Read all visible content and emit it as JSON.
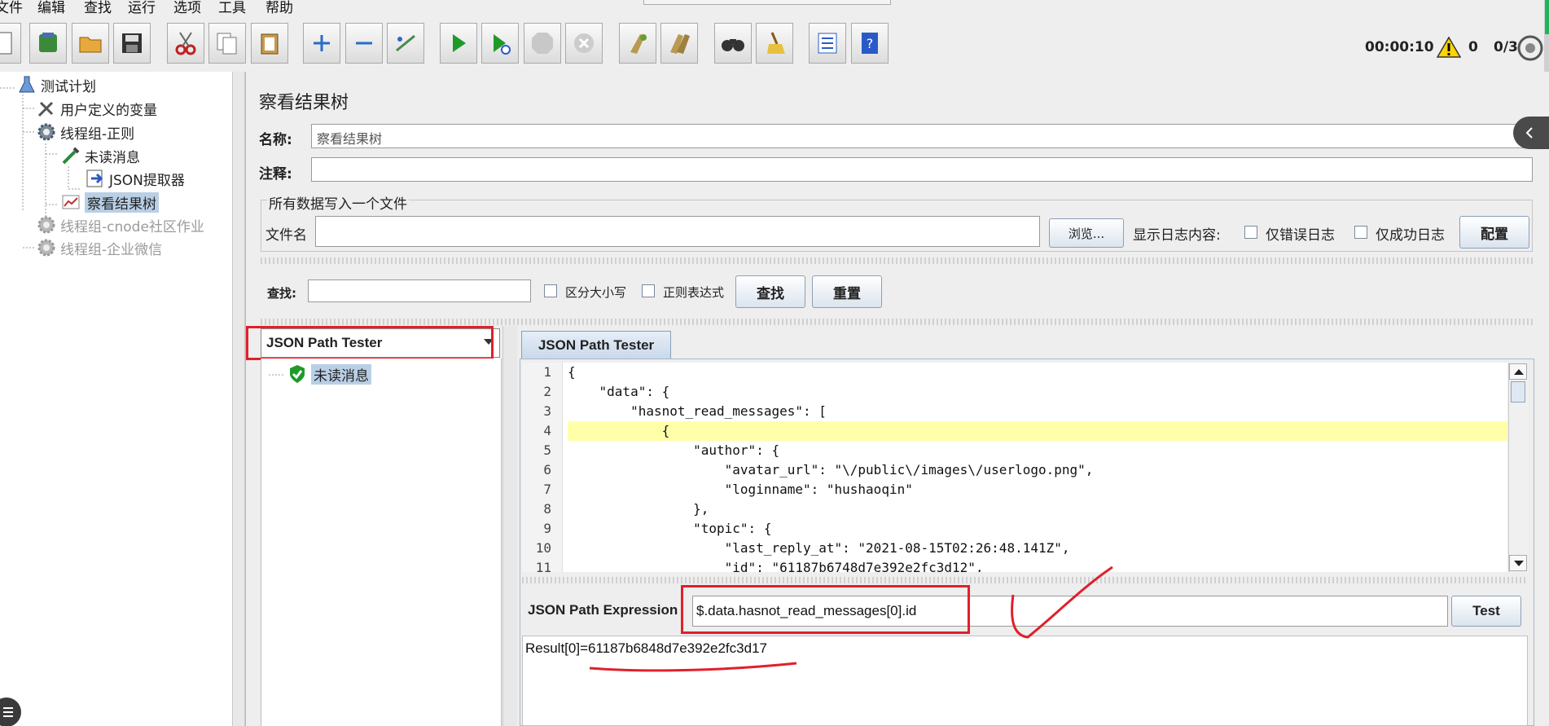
{
  "menu": [
    "文件",
    "编辑",
    "查找",
    "运行",
    "选项",
    "工具",
    "帮助"
  ],
  "status": {
    "timer": "00:00:10",
    "warnings": "0",
    "threads": "0/3"
  },
  "tree": [
    {
      "label": "测试计划",
      "icon": "flask-icon",
      "disabled": false,
      "selected": false
    },
    {
      "label": "用户定义的变量",
      "icon": "wrench-icon",
      "disabled": false,
      "selected": false
    },
    {
      "label": "线程组-正则",
      "icon": "gear-icon",
      "disabled": false,
      "selected": false
    },
    {
      "label": "未读消息",
      "icon": "pipette-icon",
      "disabled": false,
      "selected": false
    },
    {
      "label": "JSON提取器",
      "icon": "extractor-icon",
      "disabled": false,
      "selected": false
    },
    {
      "label": "察看结果树",
      "icon": "chart-icon",
      "disabled": false,
      "selected": true
    },
    {
      "label": "线程组-cnode社区作业",
      "icon": "gear-icon",
      "disabled": true,
      "selected": false
    },
    {
      "label": "线程组-企业微信",
      "icon": "gear-icon",
      "disabled": true,
      "selected": false
    }
  ],
  "panel": {
    "title": "察看结果树",
    "name_label": "名称:",
    "name_value": "察看结果树",
    "comment_label": "注释:",
    "comment_value": "",
    "file_group_title": "所有数据写入一个文件",
    "filename_label": "文件名",
    "filename_value": "",
    "browse_label": "浏览...",
    "log_label": "显示日志内容:",
    "errors_only_label": "仅错误日志",
    "success_only_label": "仅成功日志",
    "config_label": "配置",
    "search_label": "查找:",
    "search_value": "",
    "case_label": "区分大小写",
    "regex_label": "正则表达式",
    "find_label": "查找",
    "reset_label": "重置"
  },
  "results": {
    "renderer": "JSON Path Tester",
    "items": [
      {
        "label": "未读消息",
        "status": "success"
      }
    ],
    "tab_label": "JSON Path Tester",
    "code_lines": [
      "{",
      "    \"data\": {",
      "        \"hasnot_read_messages\": [",
      "            {",
      "                \"author\": {",
      "                    \"avatar_url\": \"\\/public\\/images\\/userlogo.png\",",
      "                    \"loginname\": \"hushaoqin\"",
      "                },",
      "                \"topic\": {",
      "                    \"last_reply_at\": \"2021-08-15T02:26:48.141Z\",",
      "                    \"id\": \"61187b6748d7e392e2fc3d12\","
    ],
    "expression_label": "JSON Path Expression",
    "expression_value": "$.data.hasnot_read_messages[0].id",
    "test_label": "Test",
    "result_text": "Result[0]=61187b6848d7e392e2fc3d17"
  },
  "colors": {
    "annotation_red": "#e0202a",
    "highlight": "#ffffaa",
    "selection": "#b9cfe6"
  }
}
